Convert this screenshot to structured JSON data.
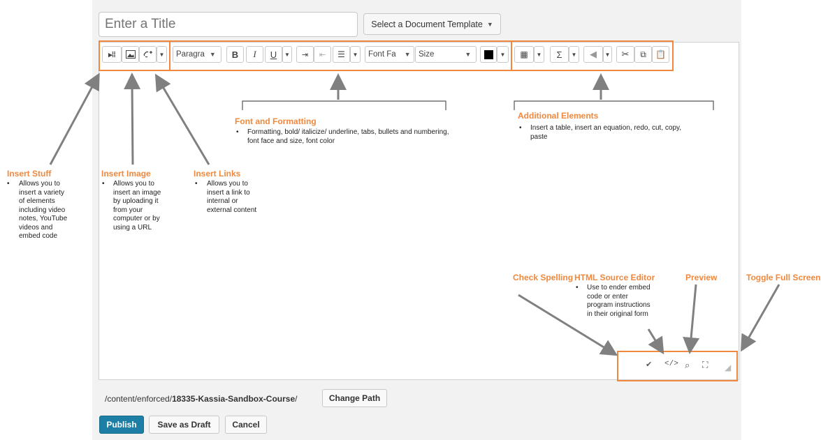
{
  "title_field": {
    "placeholder": "Enter a Title"
  },
  "template_button": {
    "label": "Select a Document Template"
  },
  "toolbar": {
    "paragraph_value": "Paragra",
    "bold": "B",
    "italic": "I",
    "underline": "U",
    "font_face_value": "Font Fa",
    "size_value": "Size",
    "sigma": "Σ"
  },
  "annotations": {
    "insert_stuff": {
      "title": "Insert Stuff",
      "lines": [
        "Allows you to",
        "insert a variety",
        "of elements",
        "including video",
        "notes, YouTube",
        "videos and",
        "embed  code"
      ]
    },
    "insert_image": {
      "title": "Insert Image",
      "lines": [
        "Allows you to",
        "insert an image",
        "by uploading it",
        "from your",
        "computer or by",
        "using a URL"
      ]
    },
    "insert_links": {
      "title": "Insert Links",
      "lines": [
        "Allows you to",
        "insert a link to",
        "internal or",
        "external content"
      ]
    },
    "font_formatting": {
      "title": "Font and Formatting",
      "lines": [
        "Formatting, bold/ italicize/ underline, tabs, bullets and numbering,",
        "font face and size, font color"
      ]
    },
    "additional_elements": {
      "title": "Additional Elements",
      "lines": [
        "Insert a table, insert an equation, redo, cut, copy,",
        "paste"
      ]
    },
    "check_spelling": {
      "title": "Check Spelling"
    },
    "html_source": {
      "title": "HTML Source Editor",
      "lines": [
        "Use to ender embed",
        "code or enter",
        "program instructions",
        "in their original form"
      ]
    },
    "preview": {
      "title": "Preview"
    },
    "toggle_full": {
      "title": "Toggle Full Screen"
    }
  },
  "footer": {
    "path_prefix": "/content/enforced/",
    "path_course": "18335-Kassia-Sandbox-Course",
    "path_suffix": "/",
    "change_path": "Change Path",
    "publish": "Publish",
    "save_draft": "Save as Draft",
    "cancel": "Cancel"
  },
  "colors": {
    "accent": "#f0883e",
    "primary_button": "#1e7fa6",
    "arrow": "#808080"
  },
  "icons": [
    "insert-stuff-icon",
    "insert-image-icon",
    "insert-link-icon",
    "indent-icon",
    "outdent-icon",
    "bullet-list-icon",
    "font-color-icon",
    "table-icon",
    "equation-icon",
    "redo-icon",
    "cut-icon",
    "copy-icon",
    "paste-icon",
    "spellcheck-icon",
    "html-source-icon",
    "preview-icon",
    "fullscreen-icon",
    "resize-handle-icon"
  ]
}
